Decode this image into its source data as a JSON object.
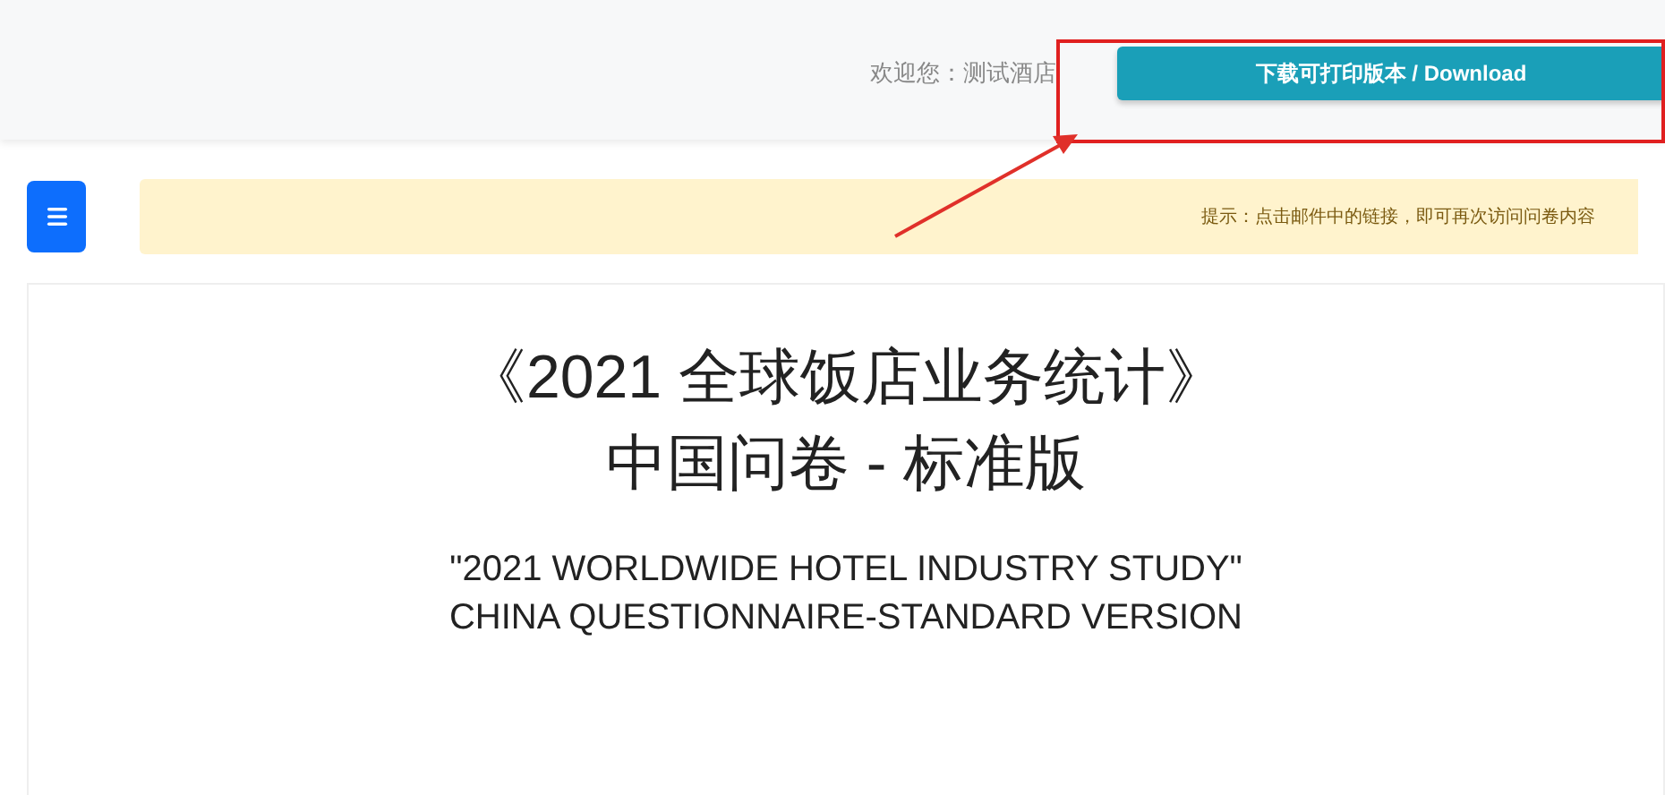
{
  "header": {
    "welcome": "欢迎您：测试酒店",
    "download_button": "下载可打印版本 / Download"
  },
  "notice": {
    "text": "提示：点击邮件中的链接，即可再次访问问卷内容"
  },
  "document": {
    "title_lines": [
      "《2021 全球饭店业务统计》",
      "中国问卷 - 标准版"
    ],
    "subtitle_lines": [
      "\"2021 WORLDWIDE HOTEL INDUSTRY STUDY\"",
      "CHINA QUESTIONNAIRE-STANDARD VERSION"
    ]
  }
}
